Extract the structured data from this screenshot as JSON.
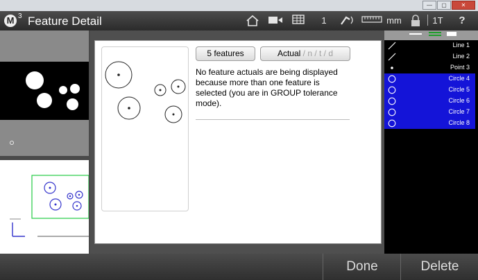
{
  "window": {
    "min": "—",
    "max": "▢",
    "close": "✕"
  },
  "app": {
    "logo_letter": "M",
    "logo_sup": "3",
    "title": "Feature Detail"
  },
  "toolbar": {
    "count": "1",
    "units": "mm",
    "tolerance_mode": "1T",
    "help": "?"
  },
  "dialog": {
    "features_button": "5 features",
    "actual_button": {
      "active": "Actual",
      "inactive": " / n / t / d"
    },
    "message": "No feature actuals are being displayed because more than one feature is selected (you are in GROUP tolerance mode)."
  },
  "features": [
    {
      "label": "Line 1",
      "type": "line",
      "selected": false
    },
    {
      "label": "Line 2",
      "type": "line",
      "selected": false
    },
    {
      "label": "Point 3",
      "type": "point",
      "selected": false
    },
    {
      "label": "Circle 4",
      "type": "circle",
      "selected": true
    },
    {
      "label": "Circle 5",
      "type": "circle",
      "selected": true
    },
    {
      "label": "Circle 6",
      "type": "circle",
      "selected": true
    },
    {
      "label": "Circle 7",
      "type": "circle",
      "selected": true
    },
    {
      "label": "Circle 8",
      "type": "circle",
      "selected": true
    }
  ],
  "bottom": {
    "done": "Done",
    "delete": "Delete"
  },
  "colors": {
    "selection": "#1414d8",
    "mini_outline": "#22cc44",
    "mini_circle": "#3333cc"
  }
}
